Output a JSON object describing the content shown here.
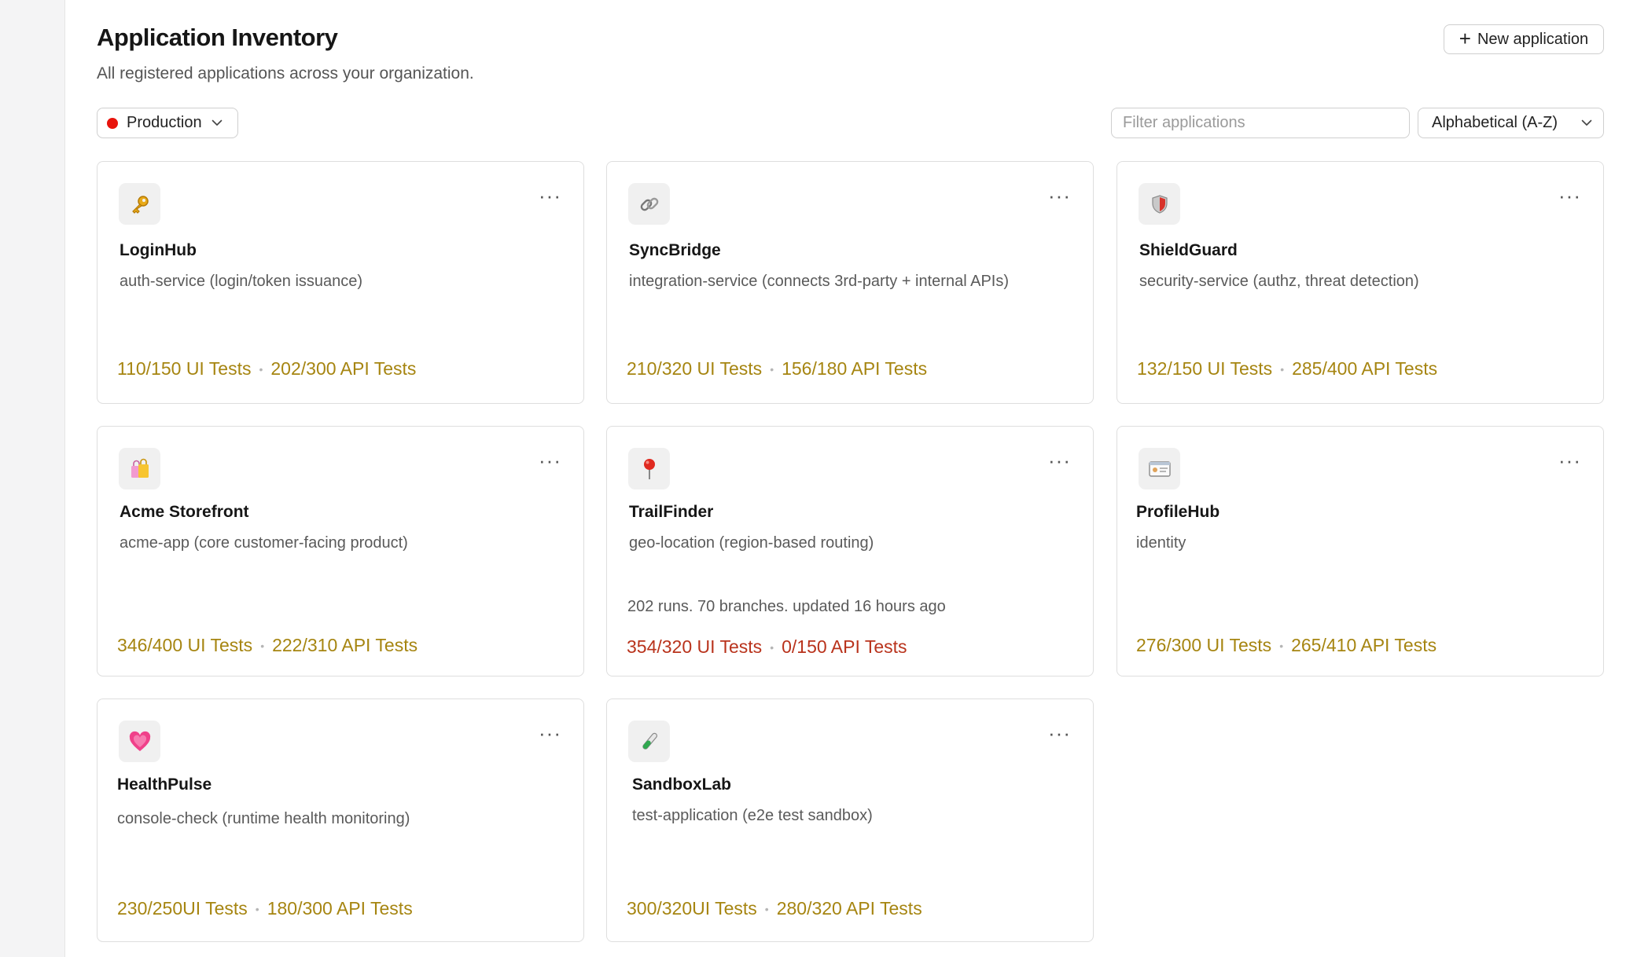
{
  "header": {
    "title": "Application Inventory",
    "subtitle": "All registered applications across your organization.",
    "new_button_label": "New application"
  },
  "filters": {
    "environment": "Production",
    "environment_color": "#e8140c",
    "search_placeholder": "Filter applications",
    "sort_label": "Alphabetical (A-Z)"
  },
  "colors": {
    "stats_ok": "#a68511",
    "stats_warning": "#b9331c"
  },
  "cards": [
    {
      "name": "LoginHub",
      "icon": "key-icon",
      "description": "auth-service (login/token issuance)",
      "meta": "",
      "ui_tests": "110/150 UI Tests",
      "api_tests": "202/300 API Tests",
      "status": "ok"
    },
    {
      "name": "SyncBridge",
      "icon": "link-icon",
      "description": "integration-service (connects 3rd-party + internal APIs)",
      "meta": "",
      "ui_tests": "210/320 UI Tests",
      "api_tests": "156/180 API Tests",
      "status": "ok"
    },
    {
      "name": "ShieldGuard",
      "icon": "shield-icon",
      "description": "security-service (authz, threat detection)",
      "meta": "",
      "ui_tests": "132/150 UI Tests",
      "api_tests": "285/400 API Tests",
      "status": "ok"
    },
    {
      "name": "Acme Storefront",
      "icon": "shopping-bags-icon",
      "description": "acme-app (core customer-facing product)",
      "meta": "",
      "ui_tests": "346/400 UI Tests",
      "api_tests": "222/310 API Tests",
      "status": "ok"
    },
    {
      "name": "TrailFinder",
      "icon": "map-pin-icon",
      "description": "geo-location (region-based routing)",
      "meta": "202 runs. 70 branches. updated 16 hours ago",
      "ui_tests": "354/320 UI Tests",
      "api_tests": "0/150 API Tests",
      "status": "warning"
    },
    {
      "name": "ProfileHub",
      "icon": "id-card-icon",
      "description": "identity",
      "meta": "",
      "ui_tests": "276/300 UI Tests",
      "api_tests": "265/410 API Tests",
      "status": "ok"
    },
    {
      "name": "HealthPulse",
      "icon": "heart-icon",
      "description": "console-check (runtime health monitoring)",
      "meta": "",
      "ui_tests": "230/250UI Tests",
      "api_tests": "180/300 API Tests",
      "status": "ok"
    },
    {
      "name": "SandboxLab",
      "icon": "test-tube-icon",
      "description": "test-application (e2e test sandbox)",
      "meta": "",
      "ui_tests": "300/320UI Tests",
      "api_tests": "280/320 API Tests",
      "status": "ok"
    }
  ]
}
